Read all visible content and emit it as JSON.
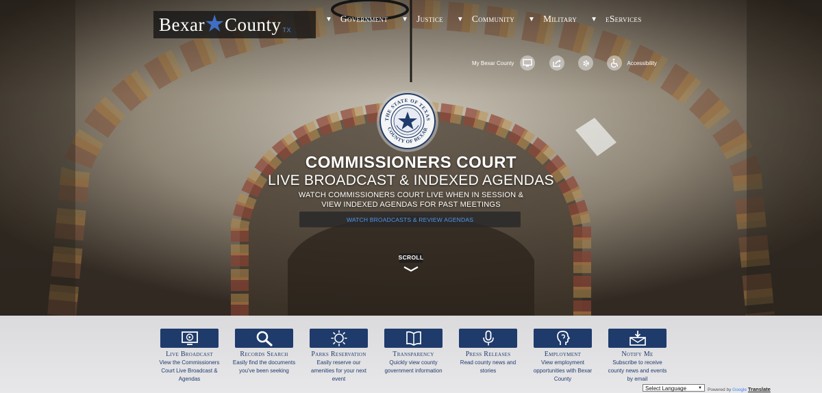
{
  "header": {
    "logo": {
      "word1": "Bexar",
      "word2": "County",
      "state": "TX"
    },
    "nav": [
      {
        "label": "Government"
      },
      {
        "label": "Justice"
      },
      {
        "label": "Community"
      },
      {
        "label": "Military"
      },
      {
        "label": "eServices"
      }
    ]
  },
  "utility": {
    "my_county_label": "My Bexar County",
    "accessibility_label": "Accessibility",
    "icons": [
      "monitor-icon",
      "share-icon",
      "settings-icon",
      "wheelchair-icon"
    ]
  },
  "seal": {
    "ring_top": "THE STATE OF TEXAS",
    "ring_bottom": "COUNTY OF BEXAR"
  },
  "hero": {
    "title": "COMMISSIONERS COURT",
    "subtitle": "LIVE BROADCAST & INDEXED AGENDAS",
    "line1": "WATCH COMMISSIONERS COURT LIVE WHEN IN SESSION &",
    "line2": "VIEW INDEXED AGENDAS FOR PAST MEETINGS",
    "cta_label": "WATCH BROADCASTS & REVIEW AGENDAS",
    "scroll_label": "SCROLL"
  },
  "quick_links": [
    {
      "title": "Live Broadcast",
      "desc": "View the Commissioners Court Live Broadcast & Agendas",
      "icon": "broadcast-icon"
    },
    {
      "title": "Records Search",
      "desc": "Easily find the documents you've been seeking",
      "icon": "search-icon"
    },
    {
      "title": "Parks Reservation",
      "desc": "Easily reserve our amenities for your next event",
      "icon": "sun-icon"
    },
    {
      "title": "Transparency",
      "desc": "Quickly view county government information",
      "icon": "book-icon"
    },
    {
      "title": "Press Releases",
      "desc": "Read county news and stories",
      "icon": "microphone-icon"
    },
    {
      "title": "Employment",
      "desc": "View employment opportunities with Bexar County",
      "icon": "head-profile-icon"
    },
    {
      "title": "Notify Me",
      "desc": "Subscribe to receive county news and events by email",
      "icon": "mail-icon"
    }
  ],
  "translate": {
    "select_label": "Select Language",
    "powered_by": "Powered by",
    "google": "Google",
    "translate_link": "Translate"
  },
  "colors": {
    "brand_blue": "#1f3b6b",
    "cta_text": "#4f97f0",
    "star": "#3f6fc4"
  }
}
